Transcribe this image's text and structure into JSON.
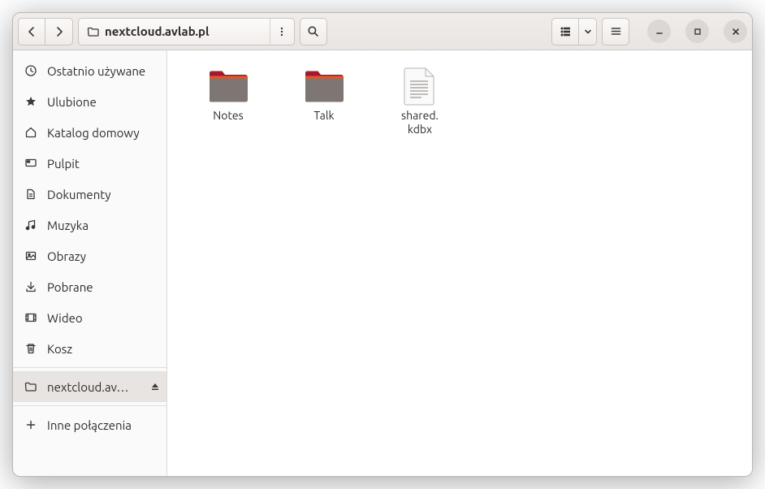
{
  "pathbar": {
    "location": "nextcloud.avlab.pl"
  },
  "sidebar": {
    "items": [
      {
        "label": "Ostatnio używane"
      },
      {
        "label": "Ulubione"
      },
      {
        "label": "Katalog domowy"
      },
      {
        "label": "Pulpit"
      },
      {
        "label": "Dokumenty"
      },
      {
        "label": "Muzyka"
      },
      {
        "label": "Obrazy"
      },
      {
        "label": "Pobrane"
      },
      {
        "label": "Wideo"
      },
      {
        "label": "Kosz"
      }
    ],
    "mount": {
      "label": "nextcloud.av…"
    },
    "other": {
      "label": "Inne połączenia"
    }
  },
  "files": {
    "items": [
      {
        "name": "Notes",
        "kind": "folder"
      },
      {
        "name": "Talk",
        "kind": "folder"
      },
      {
        "name": "shared.\nkdbx",
        "kind": "file"
      }
    ]
  }
}
